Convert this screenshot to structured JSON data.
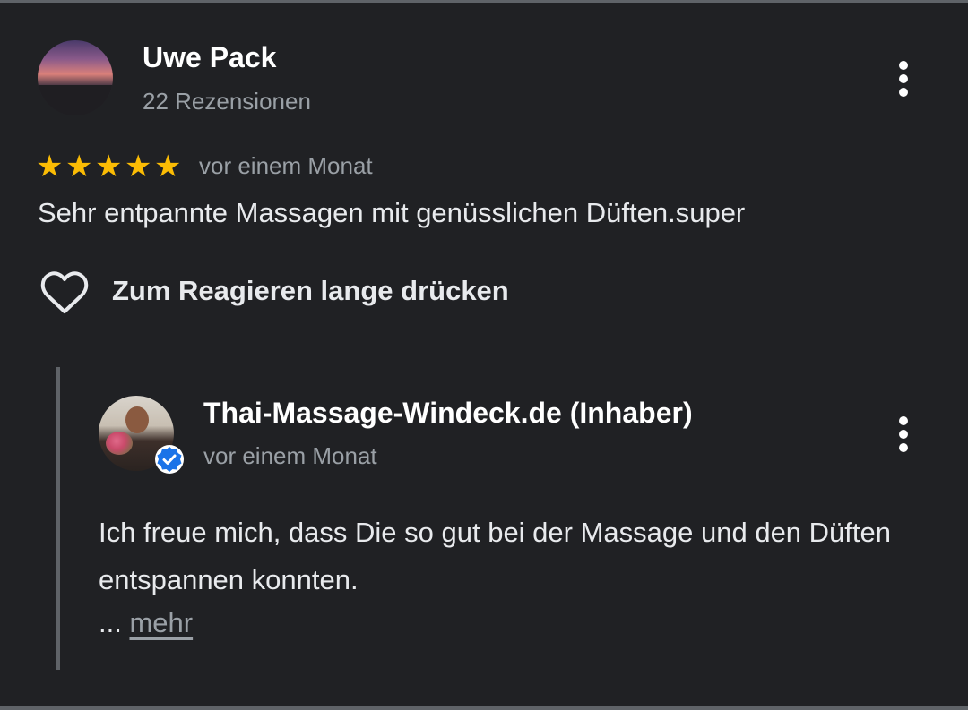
{
  "review": {
    "reviewer_name": "Uwe Pack",
    "review_count": "22 Rezensionen",
    "rating": 5,
    "rating_max": 5,
    "stars": [
      "★",
      "★",
      "★",
      "★",
      "★"
    ],
    "date": "vor einem Monat",
    "text": "Sehr entpannte Massagen mit genüsslichen Düften.super",
    "react_label": "Zum Reagieren lange drücken"
  },
  "reply": {
    "owner_name": "Thai-Massage-Windeck.de (Inhaber)",
    "date": "vor einem Monat",
    "text": "Ich freue mich, dass Die so gut bei der Massage und den Düften entspannen konnten.",
    "ellipsis": "...",
    "more_label": "mehr"
  },
  "colors": {
    "background": "#202124",
    "star": "#fbbc04",
    "secondary_text": "#9aa0a6",
    "verified_badge": "#1a73e8"
  },
  "icons": {
    "menu": "more-vert-icon",
    "react": "heart-outline-icon",
    "verified": "verified-badge-icon"
  }
}
